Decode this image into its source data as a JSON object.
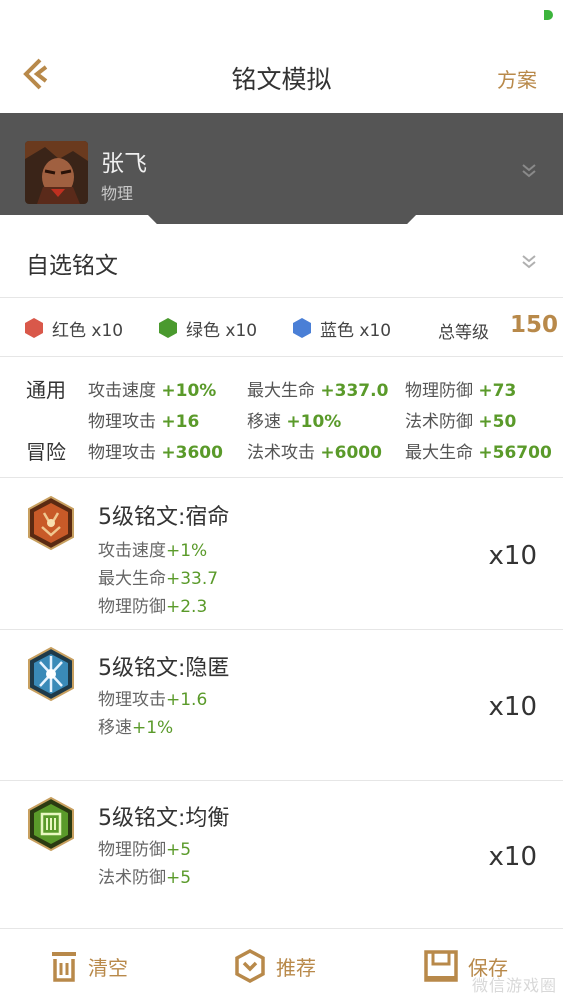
{
  "colors": {
    "accent": "#b8894a",
    "stat_green": "#5a9a2a",
    "hero_band": "#555555",
    "red": "#d9584a",
    "green": "#4a9a2e",
    "blue": "#4a7fd6"
  },
  "header": {
    "title": "铭文模拟",
    "plan_label": "方案",
    "back_icon": "chevron-left-icon"
  },
  "hero": {
    "name": "张飞",
    "type": "物理"
  },
  "selector": {
    "label": "自选铭文"
  },
  "color_counts": {
    "red": {
      "label": "红色 x10",
      "icon": "red-hexagon-icon"
    },
    "green": {
      "label": "绿色 x10",
      "icon": "green-hexagon-icon"
    },
    "blue": {
      "label": "蓝色 x10",
      "icon": "blue-hexagon-icon"
    },
    "total_label": "总等级",
    "total_value": "150"
  },
  "attributes": {
    "general_label": "通用",
    "adventure_label": "冒险",
    "general": [
      {
        "name": "攻击速度",
        "value": "+10%"
      },
      {
        "name": "最大生命",
        "value": "+337.0"
      },
      {
        "name": "物理防御",
        "value": "+73"
      },
      {
        "name": "物理攻击",
        "value": "+16"
      },
      {
        "name": "移速",
        "value": "+10%"
      },
      {
        "name": "法术防御",
        "value": "+50"
      }
    ],
    "adventure": [
      {
        "name": "物理攻击",
        "value": "+3600"
      },
      {
        "name": "法术攻击",
        "value": "+6000"
      },
      {
        "name": "最大生命",
        "value": "+56700"
      }
    ]
  },
  "runes": [
    {
      "name": "5级铭文:宿命",
      "count": "x10",
      "stats": [
        {
          "name": "攻击速度",
          "value": "+1%"
        },
        {
          "name": "最大生命",
          "value": "+33.7"
        },
        {
          "name": "物理防御",
          "value": "+2.3"
        }
      ]
    },
    {
      "name": "5级铭文:隐匿",
      "count": "x10",
      "stats": [
        {
          "name": "物理攻击",
          "value": "+1.6"
        },
        {
          "name": "移速",
          "value": "+1%"
        }
      ]
    },
    {
      "name": "5级铭文:均衡",
      "count": "x10",
      "stats": [
        {
          "name": "物理防御",
          "value": "+5"
        },
        {
          "name": "法术防御",
          "value": "+5"
        }
      ]
    }
  ],
  "bottom": {
    "clear_label": "清空",
    "recommend_label": "推荐",
    "save_label": "保存",
    "watermark": "微信游戏圈"
  }
}
